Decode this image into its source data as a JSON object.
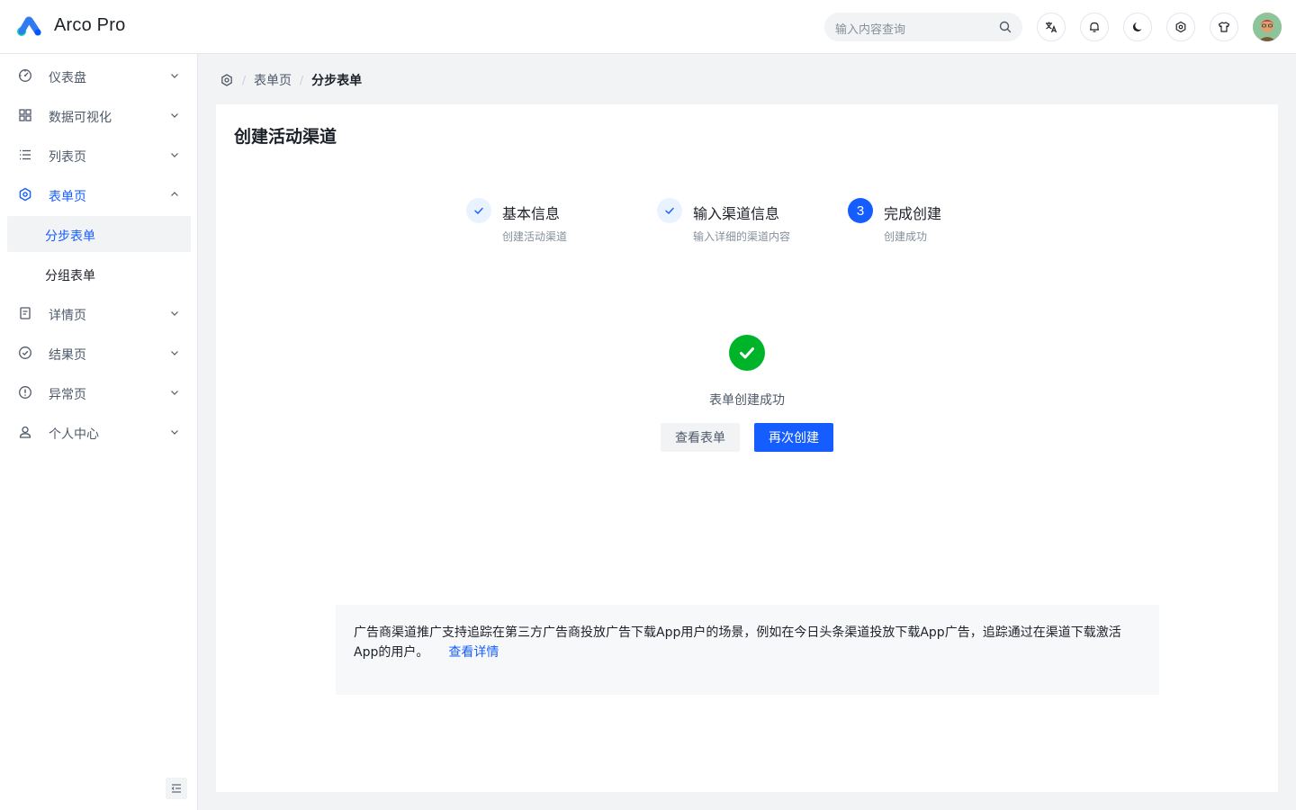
{
  "app": {
    "brand": "Arco Pro"
  },
  "header": {
    "search_placeholder": "输入内容查询",
    "icons": [
      "translate-icon",
      "bell-icon",
      "moon-icon",
      "gear-icon",
      "tshirt-icon"
    ],
    "accent": "#165dff"
  },
  "sidebar": {
    "items": [
      {
        "label": "仪表盘",
        "icon": "dashboard-icon"
      },
      {
        "label": "数据可视化",
        "icon": "grid-icon"
      },
      {
        "label": "列表页",
        "icon": "list-icon"
      },
      {
        "label": "表单页",
        "icon": "gear-icon",
        "open": true
      },
      {
        "label": "分步表单",
        "sub": true,
        "active": true
      },
      {
        "label": "分组表单",
        "sub": true
      },
      {
        "label": "详情页",
        "icon": "file-icon"
      },
      {
        "label": "结果页",
        "icon": "check-circle-icon"
      },
      {
        "label": "异常页",
        "icon": "exclamation-circle-icon"
      },
      {
        "label": "个人中心",
        "icon": "user-icon"
      }
    ]
  },
  "breadcrumb": {
    "items": [
      "表单页",
      "分步表单"
    ]
  },
  "page": {
    "title": "创建活动渠道",
    "steps": [
      {
        "title": "基本信息",
        "desc": "创建活动渠道",
        "status": "done"
      },
      {
        "title": "输入渠道信息",
        "desc": "输入详细的渠道内容",
        "status": "done"
      },
      {
        "title": "完成创建",
        "desc": "创建成功",
        "status": "current",
        "number": "3"
      }
    ],
    "result": {
      "text": "表单创建成功",
      "view_button": "查看表单",
      "again_button": "再次创建"
    },
    "info": {
      "text": "广告商渠道推广支持追踪在第三方广告商投放广告下载App用户的场景，例如在今日头条渠道投放下载App广告，追踪通过在渠道下载激活App的用户。",
      "link": "查看详情"
    }
  }
}
